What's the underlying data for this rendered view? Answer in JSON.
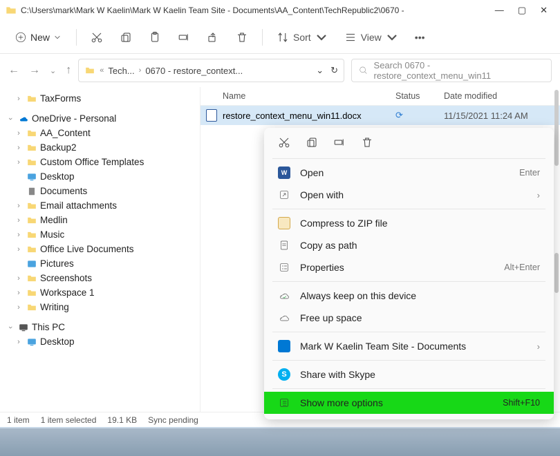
{
  "titlebar": {
    "path": "C:\\Users\\mark\\Mark W Kaelin\\Mark W Kaelin Team Site - Documents\\AA_Content\\TechRepublic2\\0670 -"
  },
  "toolbar": {
    "new_label": "New",
    "sort_label": "Sort",
    "view_label": "View"
  },
  "breadcrumb": {
    "seg1": "Tech...",
    "seg2": "0670 - restore_context..."
  },
  "search": {
    "placeholder": "Search 0670 - restore_context_menu_win11"
  },
  "columns": {
    "name": "Name",
    "status": "Status",
    "date": "Date modified"
  },
  "file": {
    "name": "restore_context_menu_win11.docx",
    "date": "11/15/2021 11:24 AM"
  },
  "tree": {
    "taxforms": "TaxForms",
    "onedrive": "OneDrive - Personal",
    "aa": "AA_Content",
    "backup2": "Backup2",
    "cot": "Custom Office Templates",
    "desktop": "Desktop",
    "documents": "Documents",
    "email": "Email attachments",
    "medlin": "Medlin",
    "music": "Music",
    "old": "Office Live Documents",
    "pictures": "Pictures",
    "screens": "Screenshots",
    "ws1": "Workspace 1",
    "writing": "Writing",
    "thispc": "This PC",
    "desktop2": "Desktop"
  },
  "context": {
    "open": "Open",
    "open_sc": "Enter",
    "openwith": "Open with",
    "zip": "Compress to ZIP file",
    "copypath": "Copy as path",
    "props": "Properties",
    "props_sc": "Alt+Enter",
    "keep": "Always keep on this device",
    "free": "Free up space",
    "teamsite": "Mark W Kaelin Team Site - Documents",
    "skype": "Share with Skype",
    "more": "Show more options",
    "more_sc": "Shift+F10"
  },
  "statusbar": {
    "count": "1 item",
    "selected": "1 item selected",
    "size": "19.1 KB",
    "sync": "Sync pending"
  }
}
